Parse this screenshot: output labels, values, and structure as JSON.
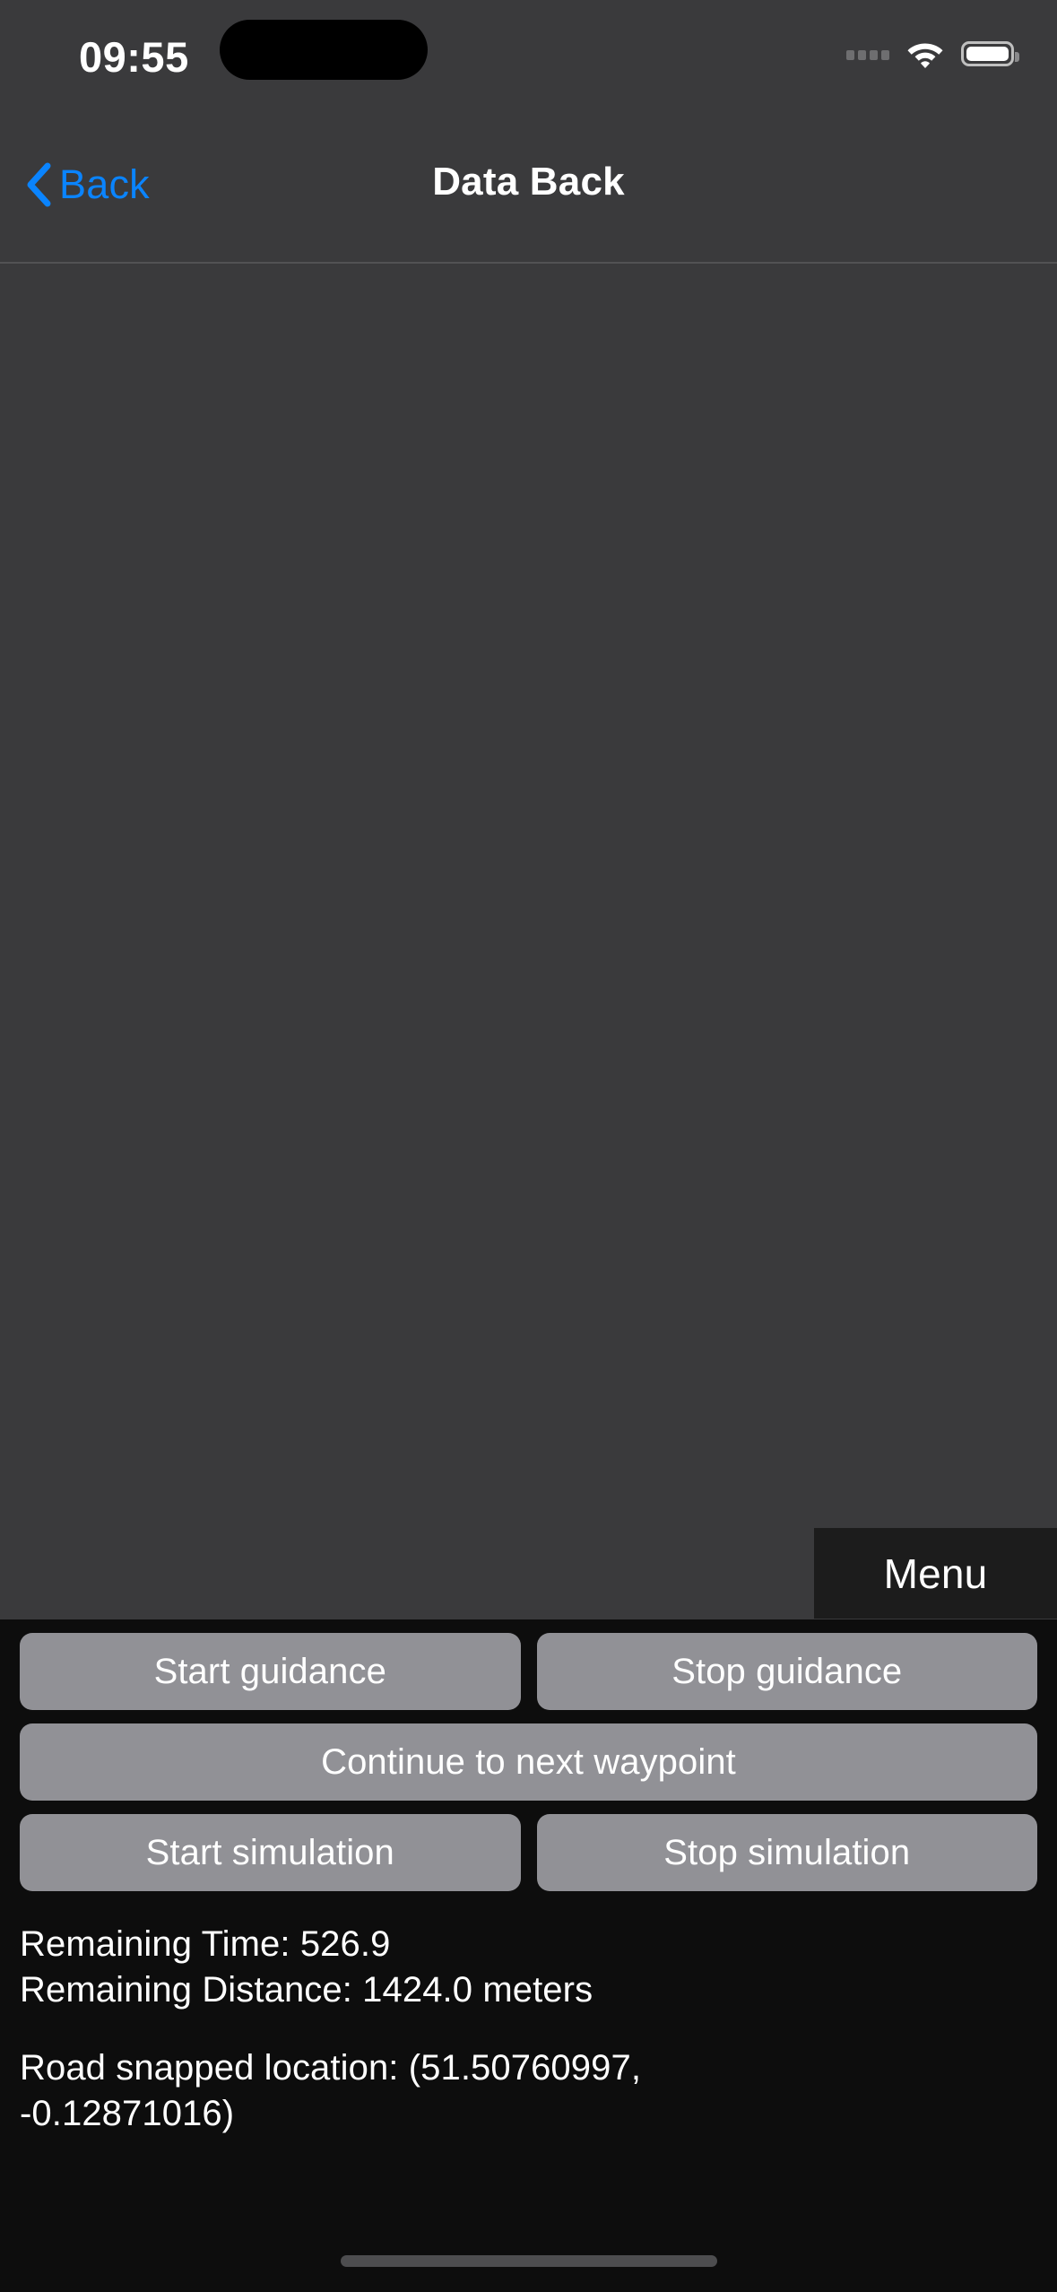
{
  "status_bar": {
    "time": "09:55",
    "signal_icon": "signal-dots-icon",
    "wifi_icon": "wifi-icon",
    "battery_icon": "battery-full-icon"
  },
  "nav_bar": {
    "back_label": "Back",
    "back_chevron_icon": "chevron-left-icon",
    "title": "Data Back"
  },
  "map": {
    "background_color": "#3a3a3c"
  },
  "menu": {
    "label": "Menu",
    "background_color": "#1c1c1c"
  },
  "controls": {
    "accent_color": "#0a84ff",
    "button_color": "#919196",
    "rows": [
      {
        "buttons": [
          "Start guidance",
          "Stop guidance"
        ]
      },
      {
        "buttons": [
          "Continue to next waypoint"
        ]
      },
      {
        "buttons": [
          "Start simulation",
          "Stop simulation"
        ]
      }
    ],
    "start_guidance": "Start guidance",
    "stop_guidance": "Stop guidance",
    "continue_waypoint": "Continue to next waypoint",
    "start_simulation": "Start simulation",
    "stop_simulation": "Stop simulation"
  },
  "info": {
    "remaining_time": "Remaining Time: 526.9",
    "remaining_distance": "Remaining Distance: 1424.0 meters",
    "road_snapped_location": "Road snapped location: (51.50760997, -0.12871016)"
  }
}
